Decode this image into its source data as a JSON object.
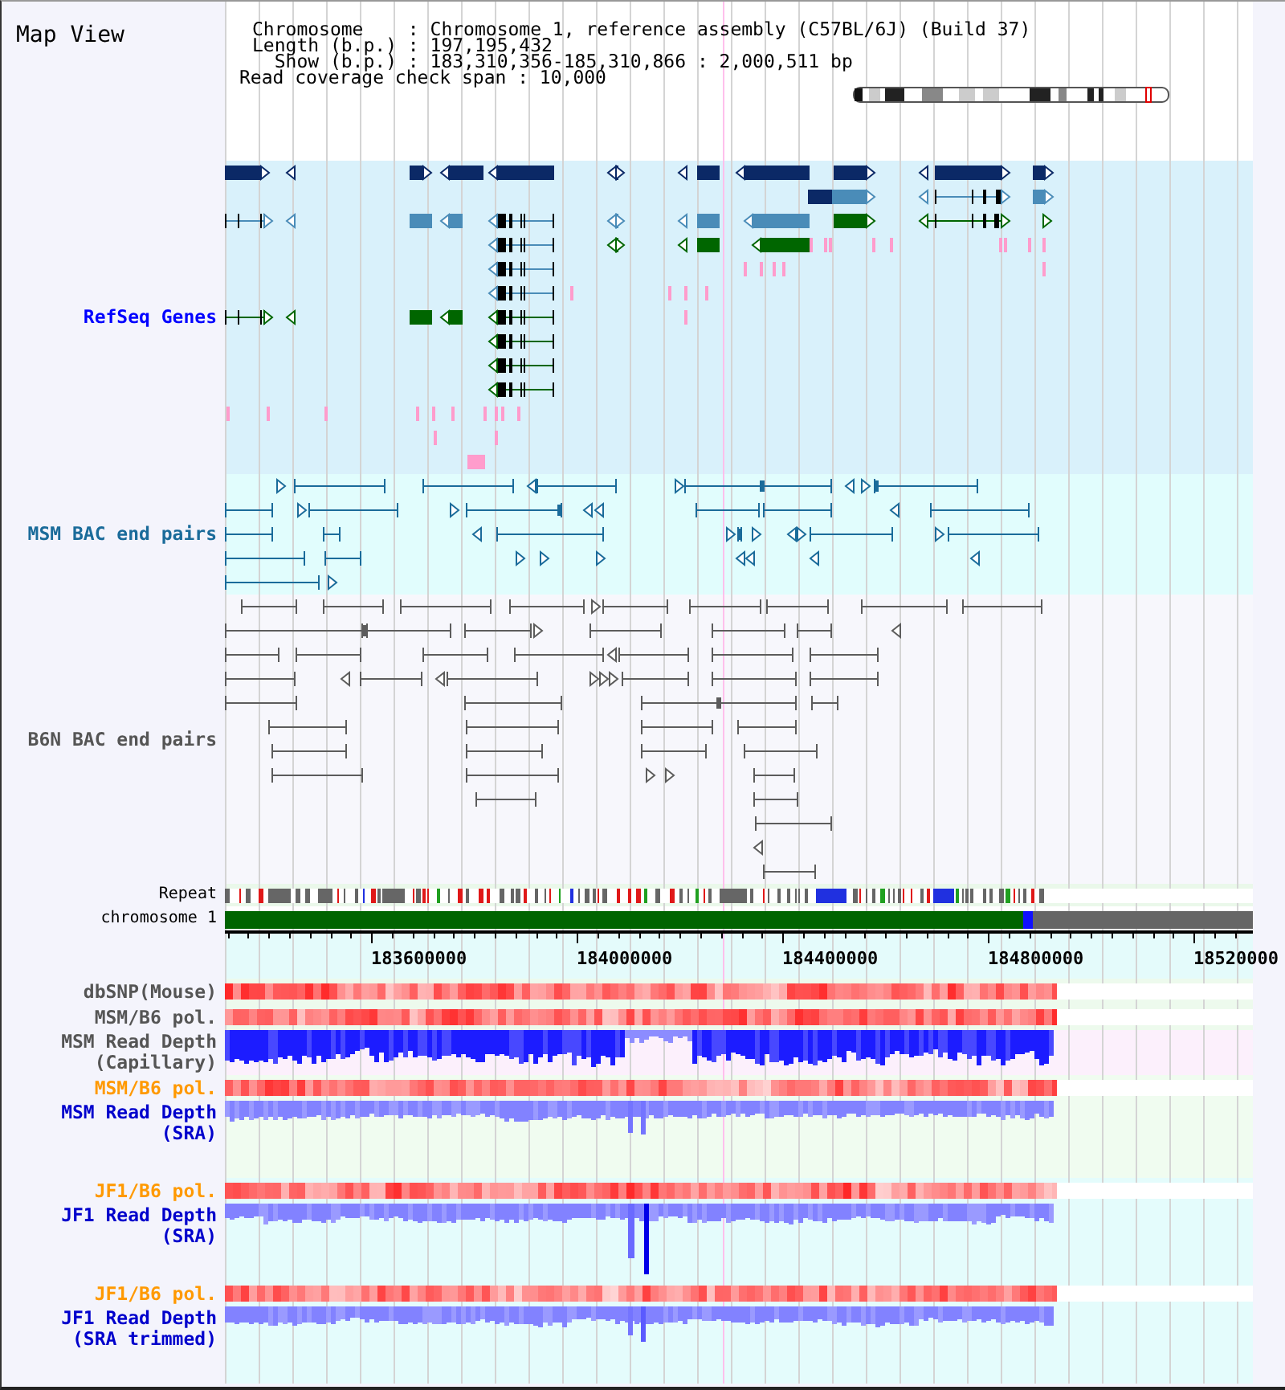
{
  "title": "Map View",
  "info": {
    "lines": [
      "Chromosome    : Chromosome 1, reference assembly (C57BL/6J) (Build 37)",
      "Length (b.p.) : 197,195,432",
      "  Show (b.p.) : 183,310,356-185,310,866 : 2,000,511 bp"
    ],
    "coverage_span": "Read coverage check span : 10,000"
  },
  "feature_tracks": [
    {
      "label": "RefSeq Genes",
      "color": "#0000ff"
    },
    {
      "label": "MSM BAC end pairs",
      "color": "#1a6b9a"
    },
    {
      "label": "B6N BAC end pairs",
      "color": "#555555"
    }
  ],
  "repeat_track": {
    "label": "Repeat"
  },
  "chromosome_track": {
    "label": "chromosome 1"
  },
  "axis": {
    "ticks": [
      "183600000",
      "184000000",
      "184400000",
      "184800000",
      "18520000"
    ]
  },
  "data_tracks": [
    {
      "tracks": [
        {
          "label": "dbSNP(Mouse)",
          "color": "#555555",
          "kind": "snp"
        },
        {
          "label": "MSM/B6 pol.",
          "color": "#555555",
          "kind": "snp"
        }
      ]
    },
    {
      "tracks": [
        {
          "label": "MSM Read Depth (Capillary)",
          "color": "#555555",
          "kind": "capillary"
        }
      ]
    },
    {
      "tracks": [
        {
          "label": "MSM/B6 pol.",
          "color": "#ff9900",
          "kind": "snp"
        },
        {
          "label": "MSM Read Depth (SRA)",
          "color": "#0000cc",
          "kind": "sra"
        }
      ]
    },
    {
      "tracks": [
        {
          "label": "JF1/B6 pol.",
          "color": "#ff9900",
          "kind": "snp"
        },
        {
          "label": "JF1 Read Depth (SRA)",
          "color": "#0000cc",
          "kind": "sra"
        },
        {
          "label": "JF1/B6 pol.",
          "color": "#ff9900",
          "kind": "snp"
        },
        {
          "label": "JF1 Read Depth (SRA trimmed)",
          "color": "#0000cc",
          "kind": "sra"
        }
      ]
    }
  ]
}
